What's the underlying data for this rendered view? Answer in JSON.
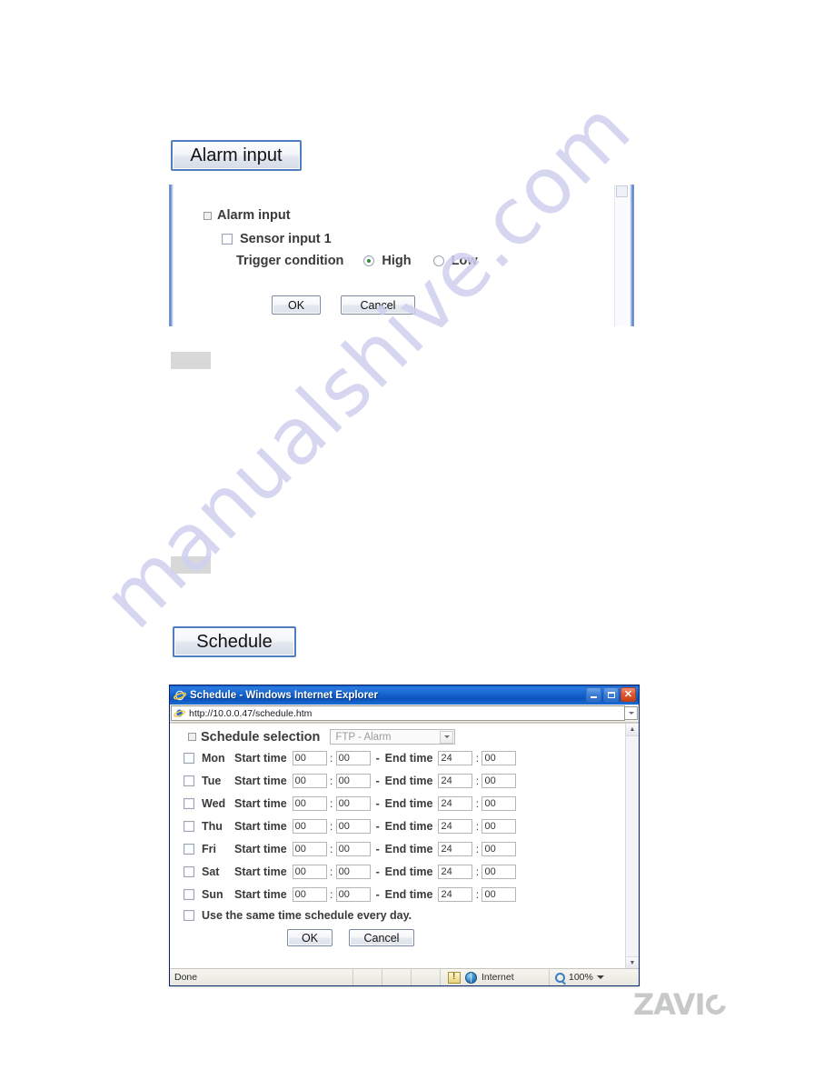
{
  "watermark": {
    "text": "manualshive.com"
  },
  "brand": {
    "logo_text": "ZAVI",
    "logo_mark": "o-mark-icon"
  },
  "alarm_section": {
    "tab_label": "Alarm input",
    "tree_header": "Alarm input",
    "sensor_label": "Sensor input 1",
    "trigger_label": "Trigger condition",
    "trigger_options": [
      {
        "label": "High",
        "selected": true
      },
      {
        "label": "Low",
        "selected": false
      }
    ],
    "ok_label": "OK",
    "cancel_label": "Cancel"
  },
  "schedule_section": {
    "tab_label": "Schedule"
  },
  "ie_window": {
    "title": "Schedule - Windows Internet Explorer",
    "url": "http://10.0.0.47/schedule.htm",
    "controls": {
      "minimize": "minimize-icon",
      "maximize": "maximize-icon",
      "close": "close-icon",
      "close_glyph": "✕"
    },
    "statusbar": {
      "status_text": "Done",
      "zone_text": "Internet",
      "zoom_text": "100%"
    }
  },
  "schedule_form": {
    "selection_label": "Schedule selection",
    "selection_value": "FTP - Alarm",
    "start_label": "Start time",
    "end_label": "End time",
    "dash": "-",
    "colon": ":",
    "rows": [
      {
        "day": "Mon",
        "checked": false,
        "start_h": "00",
        "start_m": "00",
        "end_h": "24",
        "end_m": "00"
      },
      {
        "day": "Tue",
        "checked": false,
        "start_h": "00",
        "start_m": "00",
        "end_h": "24",
        "end_m": "00"
      },
      {
        "day": "Wed",
        "checked": false,
        "start_h": "00",
        "start_m": "00",
        "end_h": "24",
        "end_m": "00"
      },
      {
        "day": "Thu",
        "checked": false,
        "start_h": "00",
        "start_m": "00",
        "end_h": "24",
        "end_m": "00"
      },
      {
        "day": "Fri",
        "checked": false,
        "start_h": "00",
        "start_m": "00",
        "end_h": "24",
        "end_m": "00"
      },
      {
        "day": "Sat",
        "checked": false,
        "start_h": "00",
        "start_m": "00",
        "end_h": "24",
        "end_m": "00"
      },
      {
        "day": "Sun",
        "checked": false,
        "start_h": "00",
        "start_m": "00",
        "end_h": "24",
        "end_m": "00"
      }
    ],
    "same_time_label": "Use the same time schedule every day.",
    "ok_label": "OK",
    "cancel_label": "Cancel"
  },
  "colors": {
    "tab_border": "#4f7ec0",
    "title_blue": "#1664cf",
    "close_red": "#c73f17",
    "radio_green": "#2e8b3a",
    "logo_gray": "#c6c8ca",
    "watermark": "#cfd0ef"
  }
}
